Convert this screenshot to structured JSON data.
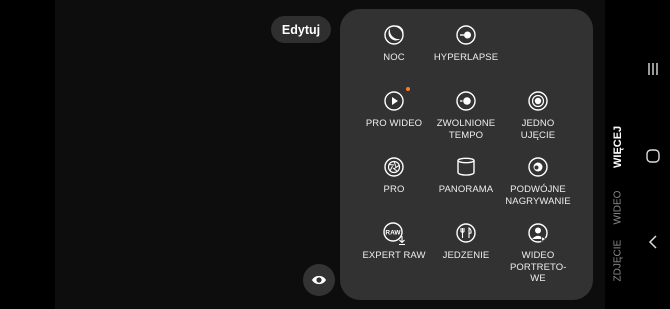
{
  "toolbar": {
    "edit_label": "Edytuj"
  },
  "modes": [
    {
      "label": "NOC",
      "icon": "moon-icon",
      "is_new": false
    },
    {
      "label": "HYPERLAPSE",
      "icon": "hyperlapse-icon",
      "is_new": false
    },
    {
      "label": "PRO WIDEO",
      "icon": "pro-video-icon",
      "is_new": true
    },
    {
      "label": "ZWOLNIONE TEMPO",
      "icon": "slow-motion-icon",
      "is_new": false
    },
    {
      "label": "JEDNO UJĘCIE",
      "icon": "single-take-icon",
      "is_new": false
    },
    {
      "label": "PRO",
      "icon": "aperture-icon",
      "is_new": false
    },
    {
      "label": "PANORAMA",
      "icon": "panorama-icon",
      "is_new": false
    },
    {
      "label": "PODWÓJNE NAGRYWANIE",
      "icon": "dual-recording-icon",
      "is_new": false
    },
    {
      "label": "EXPERT RAW",
      "icon": "expert-raw-icon",
      "is_new": false,
      "badge": "RAW"
    },
    {
      "label": "JEDZENIE",
      "icon": "food-icon",
      "is_new": false
    },
    {
      "label": "WIDEO PORTRETO-WE",
      "icon": "portrait-video-icon",
      "is_new": false
    }
  ],
  "tabs": {
    "more": "WIĘCEJ",
    "video": "WIDEO",
    "photo": "ZDJĘCIE",
    "active": "more"
  },
  "colors": {
    "panel": "#323232",
    "new_indicator": "#ff7a2a",
    "inactive_tab": "#8c8c8c"
  },
  "nav": {
    "recents": "recents-icon",
    "home": "home-icon",
    "back": "back-icon"
  }
}
